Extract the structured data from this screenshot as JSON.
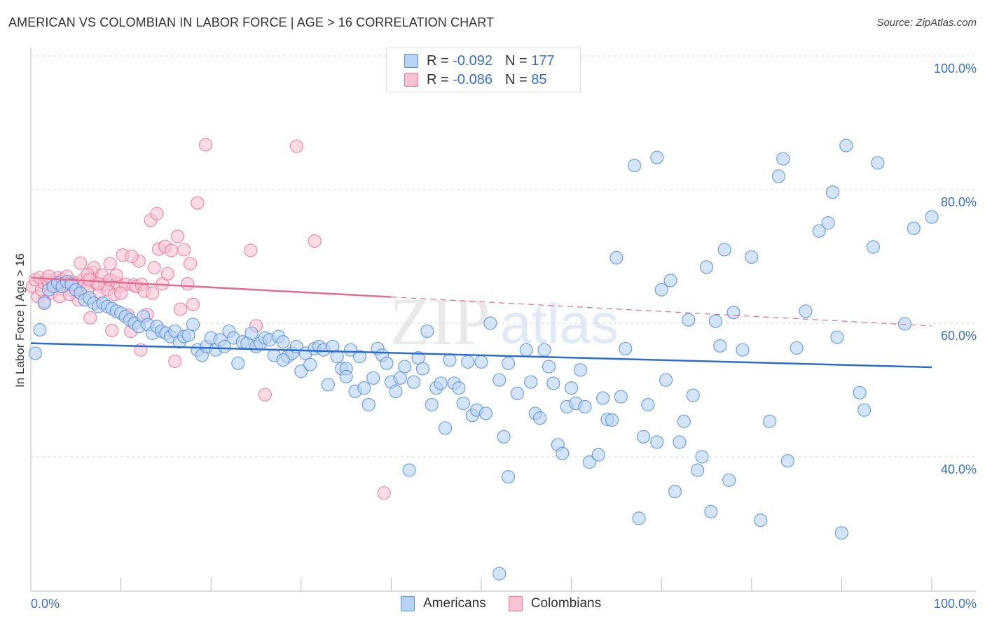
{
  "title": "AMERICAN VS COLOMBIAN IN LABOR FORCE | AGE > 16 CORRELATION CHART",
  "source": "Source: ZipAtlas.com",
  "watermark": {
    "part1": "ZIP",
    "part2": "atlas"
  },
  "legend": {
    "rows": [
      {
        "r_label": "R = ",
        "r_value": "-0.092",
        "n_label": "N = ",
        "n_value": "177"
      },
      {
        "r_label": "R = ",
        "r_value": "-0.086",
        "n_label": "N = ",
        "n_value": " 85"
      }
    ]
  },
  "colors": {
    "americans_fill": "#b8d3f5",
    "americans_stroke": "#5b8fdc",
    "americans_line": "#2a6dcf",
    "colombians_fill": "#f8c4d4",
    "colombians_stroke": "#e8799c",
    "colombians_line": "#e36a90",
    "tick_label": "#3a6fd0"
  },
  "chart_data": {
    "type": "scatter",
    "title": "AMERICAN VS COLOMBIAN IN LABOR FORCE | AGE > 16 CORRELATION CHART",
    "xlabel": "",
    "ylabel": "In Labor Force | Age > 16",
    "xlim": [
      0,
      100
    ],
    "ylim": [
      20,
      100
    ],
    "x_tick_labels": [
      "0.0%",
      "100.0%"
    ],
    "y_ticks": [
      100,
      80,
      60,
      40
    ],
    "y_tick_labels": [
      "100.0%",
      "80.0%",
      "60.0%",
      "40.0%"
    ],
    "grid": true,
    "legend_position": "bottom-center",
    "legend_labels": [
      "Americans",
      "Colombians"
    ],
    "series": [
      {
        "name": "Americans",
        "R": -0.092,
        "N": 177,
        "trend": {
          "x": [
            0,
            100
          ],
          "y": [
            57.0,
            53.4
          ]
        },
        "points": [
          [
            0.5,
            55.5
          ],
          [
            1.0,
            59.0
          ],
          [
            1.5,
            63.0
          ],
          [
            2.0,
            65.0
          ],
          [
            2.5,
            65.5
          ],
          [
            3.0,
            66.0
          ],
          [
            3.5,
            65.5
          ],
          [
            4.0,
            66.2
          ],
          [
            4.5,
            65.8
          ],
          [
            5.0,
            65.0
          ],
          [
            5.5,
            64.5
          ],
          [
            6.0,
            63.5
          ],
          [
            6.5,
            63.8
          ],
          [
            7.0,
            63.0
          ],
          [
            7.5,
            62.5
          ],
          [
            8.0,
            63.0
          ],
          [
            8.5,
            62.5
          ],
          [
            9.0,
            62.2
          ],
          [
            9.5,
            61.8
          ],
          [
            10.0,
            61.5
          ],
          [
            10.5,
            61.0
          ],
          [
            11.0,
            60.5
          ],
          [
            11.5,
            60.0
          ],
          [
            12.0,
            59.5
          ],
          [
            12.5,
            61.0
          ],
          [
            13.0,
            59.8
          ],
          [
            13.5,
            58.5
          ],
          [
            14.0,
            59.5
          ],
          [
            14.5,
            58.8
          ],
          [
            15.0,
            58.5
          ],
          [
            15.5,
            58.0
          ],
          [
            16.0,
            58.8
          ],
          [
            16.5,
            57.2
          ],
          [
            17.0,
            58.0
          ],
          [
            17.5,
            58.2
          ],
          [
            18.0,
            59.8
          ],
          [
            18.5,
            56.0
          ],
          [
            19.0,
            55.2
          ],
          [
            19.5,
            56.5
          ],
          [
            20.0,
            57.8
          ],
          [
            20.5,
            56.0
          ],
          [
            21.0,
            57.5
          ],
          [
            21.5,
            56.5
          ],
          [
            22.0,
            58.8
          ],
          [
            22.5,
            57.8
          ],
          [
            23.0,
            54.0
          ],
          [
            23.5,
            57.2
          ],
          [
            24.0,
            57.0
          ],
          [
            24.5,
            58.5
          ],
          [
            25.0,
            56.5
          ],
          [
            25.5,
            57.0
          ],
          [
            26.0,
            57.8
          ],
          [
            26.5,
            57.5
          ],
          [
            27.0,
            55.2
          ],
          [
            27.5,
            58.0
          ],
          [
            28.0,
            57.2
          ],
          [
            28.5,
            55.0
          ],
          [
            29.0,
            55.5
          ],
          [
            29.5,
            56.5
          ],
          [
            30.0,
            52.8
          ],
          [
            30.5,
            55.5
          ],
          [
            31.0,
            53.8
          ],
          [
            31.5,
            56.2
          ],
          [
            32.0,
            56.5
          ],
          [
            32.5,
            56.0
          ],
          [
            33.0,
            50.8
          ],
          [
            33.5,
            56.5
          ],
          [
            34.0,
            55.0
          ],
          [
            34.5,
            53.2
          ],
          [
            35.0,
            53.2
          ],
          [
            35.5,
            56.0
          ],
          [
            36.0,
            49.8
          ],
          [
            36.5,
            55.0
          ],
          [
            37.0,
            50.3
          ],
          [
            37.5,
            47.8
          ],
          [
            38.0,
            51.8
          ],
          [
            38.5,
            56.2
          ],
          [
            39.0,
            55.2
          ],
          [
            39.5,
            54.0
          ],
          [
            40.0,
            51.2
          ],
          [
            40.5,
            49.8
          ],
          [
            41.0,
            51.8
          ],
          [
            41.5,
            53.5
          ],
          [
            42.0,
            38.0
          ],
          [
            42.5,
            51.2
          ],
          [
            43.0,
            54.8
          ],
          [
            43.5,
            53.2
          ],
          [
            44.0,
            58.8
          ],
          [
            44.5,
            47.8
          ],
          [
            45.0,
            50.3
          ],
          [
            45.5,
            51.0
          ],
          [
            46.0,
            44.3
          ],
          [
            46.5,
            54.5
          ],
          [
            47.0,
            51.0
          ],
          [
            47.5,
            50.3
          ],
          [
            48.0,
            48.0
          ],
          [
            48.5,
            54.2
          ],
          [
            49.0,
            46.2
          ],
          [
            49.5,
            47.0
          ],
          [
            50.0,
            54.2
          ],
          [
            50.5,
            46.5
          ],
          [
            51.0,
            60.0
          ],
          [
            52.0,
            51.5
          ],
          [
            52.5,
            43.0
          ],
          [
            53.0,
            54.0
          ],
          [
            54.0,
            49.5
          ],
          [
            55.0,
            56.0
          ],
          [
            55.5,
            51.2
          ],
          [
            56.0,
            46.5
          ],
          [
            56.5,
            45.8
          ],
          [
            57.0,
            56.0
          ],
          [
            57.5,
            53.5
          ],
          [
            58.0,
            51.0
          ],
          [
            58.5,
            41.8
          ],
          [
            59.0,
            40.5
          ],
          [
            59.5,
            47.5
          ],
          [
            60.0,
            50.3
          ],
          [
            60.5,
            48.0
          ],
          [
            61.0,
            53.0
          ],
          [
            61.5,
            47.5
          ],
          [
            62.0,
            39.2
          ],
          [
            63.0,
            40.3
          ],
          [
            63.5,
            48.8
          ],
          [
            64.0,
            45.6
          ],
          [
            64.5,
            45.5
          ],
          [
            65.0,
            69.8
          ],
          [
            65.5,
            49.0
          ],
          [
            66.0,
            56.2
          ],
          [
            67.0,
            83.6
          ],
          [
            67.5,
            30.8
          ],
          [
            68.0,
            43.0
          ],
          [
            68.5,
            47.8
          ],
          [
            69.5,
            84.8
          ],
          [
            69.5,
            42.2
          ],
          [
            70.0,
            65.0
          ],
          [
            70.5,
            51.5
          ],
          [
            71.0,
            66.4
          ],
          [
            71.5,
            34.8
          ],
          [
            72.0,
            42.2
          ],
          [
            72.5,
            45.3
          ],
          [
            73.0,
            60.5
          ],
          [
            73.5,
            49.2
          ],
          [
            74.0,
            38.0
          ],
          [
            74.5,
            40.0
          ],
          [
            75.0,
            68.4
          ],
          [
            75.5,
            31.8
          ],
          [
            76.0,
            60.3
          ],
          [
            76.5,
            56.6
          ],
          [
            77.0,
            71.0
          ],
          [
            77.5,
            36.5
          ],
          [
            78.0,
            61.6
          ],
          [
            79.0,
            56.0
          ],
          [
            80.0,
            69.9
          ],
          [
            81.0,
            30.5
          ],
          [
            82.0,
            45.3
          ],
          [
            83.0,
            82.0
          ],
          [
            83.5,
            84.6
          ],
          [
            84.0,
            39.4
          ],
          [
            85.0,
            56.3
          ],
          [
            86.0,
            61.8
          ],
          [
            87.5,
            73.8
          ],
          [
            88.5,
            75.0
          ],
          [
            89.0,
            79.6
          ],
          [
            89.5,
            57.9
          ],
          [
            90.0,
            28.6
          ],
          [
            90.5,
            86.6
          ],
          [
            92.0,
            49.6
          ],
          [
            92.5,
            47.0
          ],
          [
            93.5,
            71.4
          ],
          [
            94.0,
            84.0
          ],
          [
            97.0,
            59.9
          ],
          [
            98.0,
            74.2
          ],
          [
            100.0,
            75.9
          ],
          [
            53.0,
            37.0
          ],
          [
            52.0,
            22.5
          ],
          [
            28.0,
            54.5
          ],
          [
            35.0,
            52.0
          ]
        ]
      },
      {
        "name": "Colombians",
        "R": -0.086,
        "N": 85,
        "trend": {
          "x": [
            0,
            100
          ],
          "y": [
            66.8,
            59.6
          ],
          "solid_until": 40
        },
        "points": [
          [
            0.2,
            65.5
          ],
          [
            0.5,
            66.5
          ],
          [
            0.8,
            64.0
          ],
          [
            1.0,
            66.8
          ],
          [
            1.2,
            65.0
          ],
          [
            1.5,
            66.0
          ],
          [
            1.8,
            66.5
          ],
          [
            2.0,
            65.8
          ],
          [
            2.2,
            64.5
          ],
          [
            2.5,
            66.2
          ],
          [
            2.8,
            65.5
          ],
          [
            3.0,
            66.8
          ],
          [
            3.3,
            65.2
          ],
          [
            3.5,
            66.5
          ],
          [
            3.8,
            66.0
          ],
          [
            4.0,
            67.0
          ],
          [
            4.2,
            65.8
          ],
          [
            4.5,
            66.2
          ],
          [
            4.8,
            64.8
          ],
          [
            5.0,
            66.0
          ],
          [
            5.2,
            65.5
          ],
          [
            5.5,
            69.0
          ],
          [
            5.8,
            66.5
          ],
          [
            6.0,
            65.8
          ],
          [
            6.3,
            65.2
          ],
          [
            6.6,
            60.8
          ],
          [
            6.8,
            67.6
          ],
          [
            7.0,
            68.3
          ],
          [
            7.3,
            66.0
          ],
          [
            7.6,
            64.5
          ],
          [
            7.9,
            67.2
          ],
          [
            8.2,
            65.8
          ],
          [
            8.5,
            65.0
          ],
          [
            8.8,
            66.5
          ],
          [
            9.0,
            58.9
          ],
          [
            9.3,
            64.3
          ],
          [
            9.6,
            66.0
          ],
          [
            9.9,
            65.5
          ],
          [
            10.2,
            70.2
          ],
          [
            10.5,
            65.8
          ],
          [
            10.8,
            61.2
          ],
          [
            11.1,
            58.8
          ],
          [
            11.4,
            65.7
          ],
          [
            11.7,
            65.5
          ],
          [
            12.0,
            69.3
          ],
          [
            12.3,
            65.8
          ],
          [
            12.6,
            64.8
          ],
          [
            12.9,
            61.3
          ],
          [
            11.2,
            70.0
          ],
          [
            12.2,
            56.0
          ],
          [
            13.3,
            75.4
          ],
          [
            13.7,
            68.3
          ],
          [
            14.0,
            76.4
          ],
          [
            14.2,
            71.1
          ],
          [
            14.6,
            65.9
          ],
          [
            14.9,
            71.5
          ],
          [
            15.2,
            67.4
          ],
          [
            15.6,
            70.9
          ],
          [
            16.0,
            54.3
          ],
          [
            16.3,
            73.0
          ],
          [
            16.6,
            62.1
          ],
          [
            17.0,
            71.0
          ],
          [
            17.4,
            65.9
          ],
          [
            17.7,
            68.9
          ],
          [
            18.0,
            62.8
          ],
          [
            18.5,
            78.0
          ],
          [
            19.4,
            86.7
          ],
          [
            24.4,
            70.9
          ],
          [
            25.0,
            59.6
          ],
          [
            26.0,
            49.3
          ],
          [
            29.5,
            86.5
          ],
          [
            31.5,
            72.3
          ],
          [
            39.2,
            34.6
          ],
          [
            1.5,
            63.2
          ],
          [
            3.2,
            64.0
          ],
          [
            5.3,
            63.5
          ],
          [
            6.3,
            67.3
          ],
          [
            8.8,
            68.9
          ],
          [
            10.0,
            64.5
          ],
          [
            2.0,
            67.0
          ],
          [
            4.3,
            64.3
          ],
          [
            6.5,
            66.5
          ],
          [
            7.5,
            65.9
          ],
          [
            13.5,
            64.5
          ],
          [
            9.5,
            67.2
          ]
        ]
      }
    ]
  }
}
